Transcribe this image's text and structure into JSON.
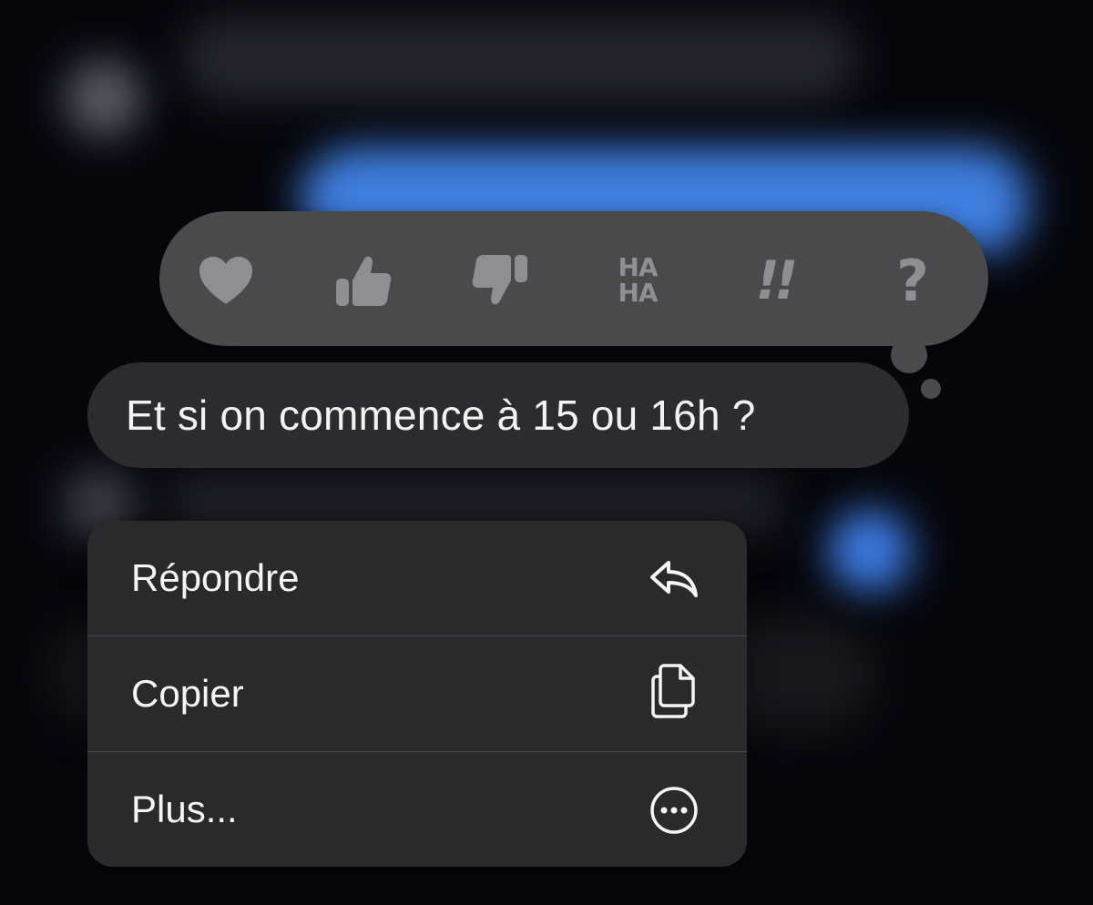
{
  "message": {
    "text": "Et si on commence à 15 ou 16h ?"
  },
  "reactions": [
    {
      "icon": "heart-icon"
    },
    {
      "icon": "thumbs-up-icon"
    },
    {
      "icon": "thumbs-down-icon"
    },
    {
      "icon": "haha-icon",
      "label_top": "HA",
      "label_bottom": "HA"
    },
    {
      "icon": "exclamation-icon",
      "label": "!!"
    },
    {
      "icon": "question-icon",
      "label": "?"
    }
  ],
  "menu": {
    "items": [
      {
        "label": "Répondre",
        "icon": "reply-icon"
      },
      {
        "label": "Copier",
        "icon": "copy-icon"
      },
      {
        "label": "Plus...",
        "icon": "more-icon"
      }
    ]
  },
  "colors": {
    "reaction_icon": "#8e8e93",
    "background": "#06070d",
    "bubble": "#2c2c30",
    "menu": "#2a2a2d",
    "accent_blue": "#3f7fe0"
  }
}
